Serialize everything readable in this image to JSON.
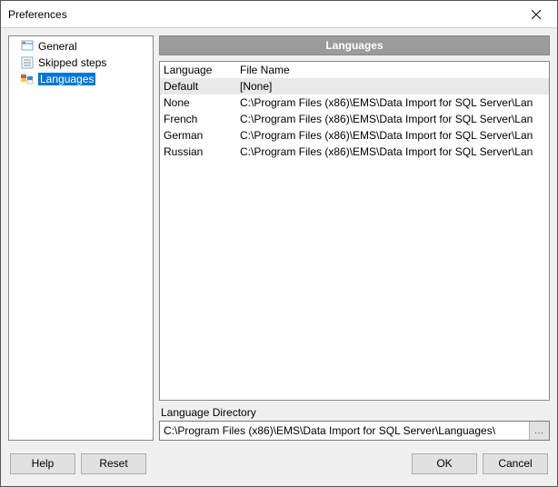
{
  "window": {
    "title": "Preferences"
  },
  "sidebar": {
    "items": [
      {
        "label": "General",
        "icon": "general"
      },
      {
        "label": "Skipped steps",
        "icon": "skipped"
      },
      {
        "label": "Languages",
        "icon": "languages",
        "selected": true
      }
    ]
  },
  "panel": {
    "header": "Languages",
    "columns": [
      "Language",
      "File Name"
    ],
    "rows": [
      {
        "lang": "Default",
        "file": "[None]",
        "default": true
      },
      {
        "lang": "None",
        "file": "C:\\Program Files (x86)\\EMS\\Data Import for SQL Server\\Lan"
      },
      {
        "lang": "French",
        "file": "C:\\Program Files (x86)\\EMS\\Data Import for SQL Server\\Lan"
      },
      {
        "lang": "German",
        "file": "C:\\Program Files (x86)\\EMS\\Data Import for SQL Server\\Lan"
      },
      {
        "lang": "Russian",
        "file": "C:\\Program Files (x86)\\EMS\\Data Import for SQL Server\\Lan"
      }
    ],
    "directory_label": "Language Directory",
    "directory_value": "C:\\Program Files (x86)\\EMS\\Data Import for SQL Server\\Languages\\"
  },
  "buttons": {
    "help": "Help",
    "reset": "Reset",
    "ok": "OK",
    "cancel": "Cancel",
    "browse": "..."
  }
}
